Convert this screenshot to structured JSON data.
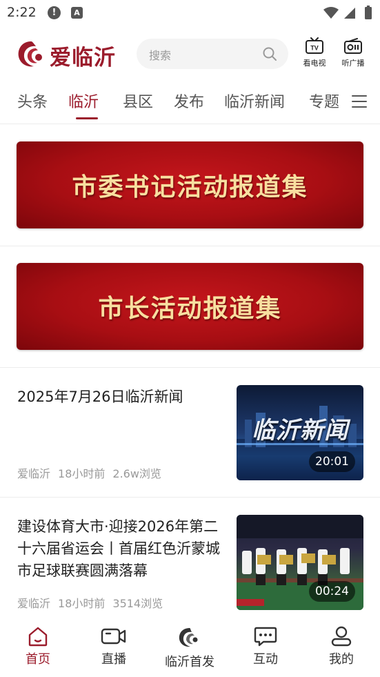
{
  "status_bar": {
    "time": "2:22",
    "alert_glyph": "!",
    "a_glyph": "A"
  },
  "header": {
    "logo_text": "爱临沂",
    "search_placeholder": "搜索",
    "tv_label": "看电视",
    "radio_label": "听广播",
    "brand_color": "#9b1c2c"
  },
  "tabs": [
    {
      "label": "头条",
      "active": false
    },
    {
      "label": "临沂",
      "active": true
    },
    {
      "label": "县区",
      "active": false
    },
    {
      "label": "发布",
      "active": false
    },
    {
      "label": "临沂新闻",
      "active": false
    },
    {
      "label": "专题",
      "active": false
    }
  ],
  "banners": [
    {
      "text": "市委书记活动报道集"
    },
    {
      "text": "市长活动报道集"
    }
  ],
  "news": [
    {
      "title": "2025年7月26日临沂新闻",
      "source": "爱临沂",
      "time": "18小时前",
      "views": "2.6w浏览",
      "thumb_caption": "临沂新闻",
      "duration": "20:01"
    },
    {
      "title": "建设体育大市·迎接2026年第二十六届省运会丨首届红色沂蒙城市足球联赛圆满落幕",
      "source": "爱临沂",
      "time": "18小时前",
      "views": "3514浏览",
      "duration": "00:24"
    }
  ],
  "bottom_nav": [
    {
      "label": "首页",
      "icon": "home-icon",
      "active": true
    },
    {
      "label": "直播",
      "icon": "video-camera-icon",
      "active": false
    },
    {
      "label": "临沂首发",
      "icon": "linyi-first-logo-icon",
      "active": false
    },
    {
      "label": "互动",
      "icon": "chat-bubble-icon",
      "active": false
    },
    {
      "label": "我的",
      "icon": "user-icon",
      "active": false
    }
  ]
}
